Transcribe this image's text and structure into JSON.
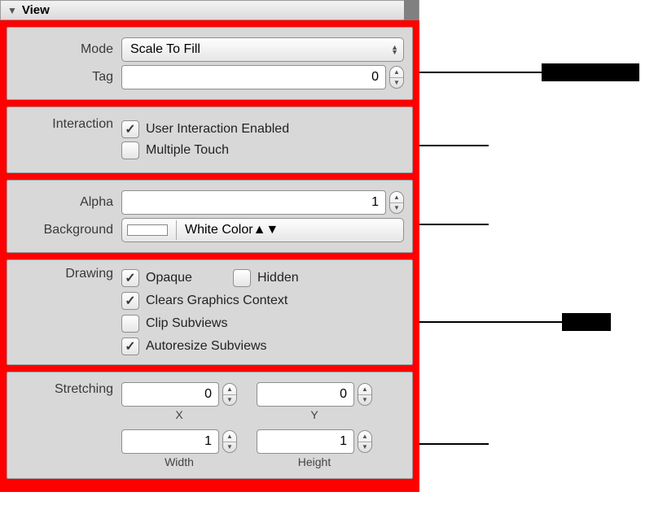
{
  "header": {
    "title": "View"
  },
  "section_mode": {
    "mode_label": "Mode",
    "mode_value": "Scale To Fill",
    "tag_label": "Tag",
    "tag_value": "0"
  },
  "section_interaction": {
    "label": "Interaction",
    "user_interaction_label": "User Interaction Enabled",
    "user_interaction_checked": true,
    "multiple_touch_label": "Multiple Touch",
    "multiple_touch_checked": false
  },
  "section_alpha": {
    "alpha_label": "Alpha",
    "alpha_value": "1",
    "background_label": "Background",
    "background_value": "White Color",
    "background_color": "#ffffff"
  },
  "section_drawing": {
    "label": "Drawing",
    "opaque_label": "Opaque",
    "opaque_checked": true,
    "hidden_label": "Hidden",
    "hidden_checked": false,
    "clears_label": "Clears Graphics Context",
    "clears_checked": true,
    "clip_label": "Clip Subviews",
    "clip_checked": false,
    "autoresize_label": "Autoresize Subviews",
    "autoresize_checked": true
  },
  "section_stretching": {
    "label": "Stretching",
    "x_label": "X",
    "x_value": "0",
    "y_label": "Y",
    "y_value": "0",
    "width_label": "Width",
    "width_value": "1",
    "height_label": "Height",
    "height_value": "1"
  }
}
